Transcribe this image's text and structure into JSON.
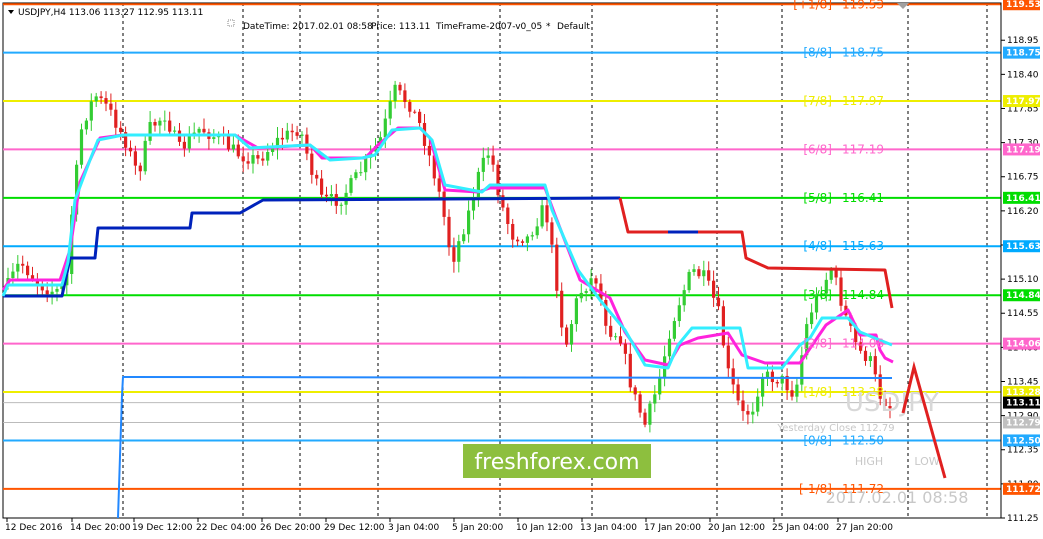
{
  "window": {
    "symbol_line": "USDJPY,H4  113.06 113.27 112.95 113.11",
    "datetime_label": "DateTime: 2017.02.01 08:58",
    "price_label": "Price: 113.11",
    "timeframe_label": "TimeFrame-2007-v0_05",
    "marker": "*",
    "default_label": "Default"
  },
  "watermark": {
    "symbol": "USDJPY",
    "yesterday_close": "Yesterday Close 112.79",
    "high_label": "HIGH",
    "low_label": "LOW",
    "timestamp": "2017.02.01 08:58",
    "brand": "freshforex.com"
  },
  "colors": {
    "bull": "#33cc33",
    "bear": "#e02020",
    "brand_bg": "#8dbf3e",
    "arrow": "#e02020"
  },
  "chart_data": {
    "type": "candlestick",
    "symbol": "USDJPY",
    "timeframe": "H4",
    "ohlc_current": {
      "open": 113.06,
      "high": 113.27,
      "low": 112.95,
      "close": 113.11
    },
    "ylim": [
      111.25,
      119.55
    ],
    "y_ticks": [
      "118.95",
      "118.40",
      "117.85",
      "117.30",
      "116.75",
      "116.20",
      "115.65",
      "115.10",
      "114.55",
      "114.00",
      "113.45",
      "112.90",
      "112.35",
      "111.80",
      "111.25"
    ],
    "x_ticks": [
      "12 Dec 2016",
      "14 Dec 20:00",
      "19 Dec 12:00",
      "22 Dec 04:00",
      "26 Dec 20:00",
      "29 Dec 12:00",
      "3 Jan 04:00",
      "5 Jan 20:00",
      "10 Jan 12:00",
      "13 Jan 04:00",
      "17 Jan 20:00",
      "20 Jan 12:00",
      "25 Jan 04:00",
      "27 Jan 20:00"
    ],
    "murrey_levels": [
      {
        "label": "[+1/8]",
        "value": "119.53",
        "color": "#ff5500"
      },
      {
        "label": "[8/8]",
        "value": "118.75",
        "color": "#22aaff"
      },
      {
        "label": "[7/8]",
        "value": "117.97",
        "color": "#eeee00"
      },
      {
        "label": "[6/8]",
        "value": "117.19",
        "color": "#ff66cc"
      },
      {
        "label": "[5/8]",
        "value": "116.41",
        "color": "#00dd00"
      },
      {
        "label": "[4/8]",
        "value": "115.63",
        "color": "#00aaff"
      },
      {
        "label": "[3/8]",
        "value": "114.84",
        "color": "#00dd00"
      },
      {
        "label": "[2/8]",
        "value": "114.06",
        "color": "#ff66cc"
      },
      {
        "label": "[1/8]",
        "value": "113.28",
        "color": "#eeee00"
      },
      {
        "label": "[0/8]",
        "value": "112.50",
        "color": "#22aaff"
      },
      {
        "label": "[-1/8]",
        "value": "111.72",
        "color": "#ff5500"
      }
    ],
    "price_tags": [
      {
        "value": "113.11",
        "color": "#000000",
        "text_color": "#ffffff"
      },
      {
        "value": "112.79",
        "color": "#c0c0c0",
        "text_color": "#ffffff"
      }
    ],
    "grid": true
  }
}
